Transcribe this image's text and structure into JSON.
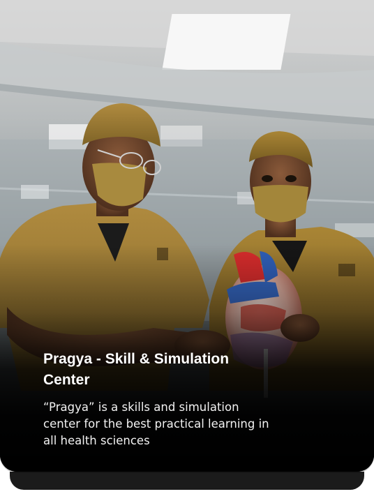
{
  "card": {
    "title": "Pragya - Skill & Simulation Center",
    "description": "“Pragya” is a skills and simulation center for the best practical learning in all health sciences",
    "image_alt": "Two medical students in surgical scrubs examining an anatomical heart model"
  },
  "colors": {
    "scrubs": "#a5823c",
    "overlay": "#000000",
    "text": "#ffffff"
  }
}
